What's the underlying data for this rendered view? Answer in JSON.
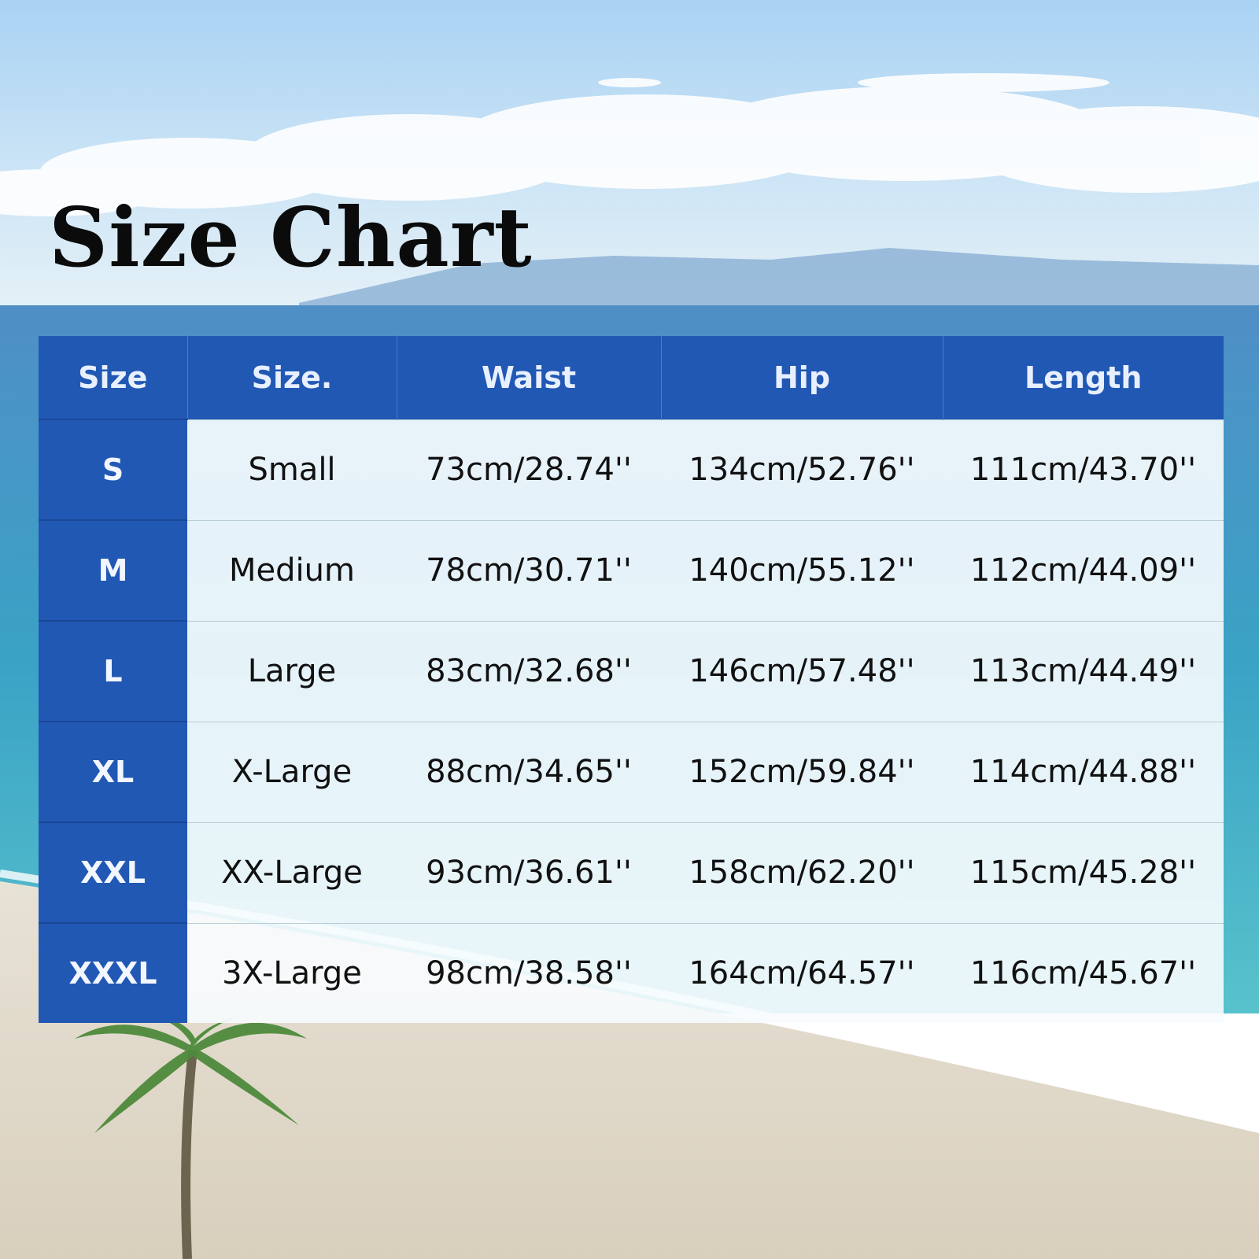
{
  "title": "Size Chart",
  "colors": {
    "header": "#2158b4",
    "cell_bg": "#f8fcfe",
    "text": "#111111"
  },
  "chart_data": {
    "type": "table",
    "title": "Size Chart",
    "columns": [
      "Size",
      "Size.",
      "Waist",
      "Hip",
      "Length"
    ],
    "rows": [
      [
        "S",
        "Small",
        "73cm/28.74''",
        "134cm/52.76''",
        "111cm/43.70''"
      ],
      [
        "M",
        "Medium",
        "78cm/30.71''",
        "140cm/55.12''",
        "112cm/44.09''"
      ],
      [
        "L",
        "Large",
        "83cm/32.68''",
        "146cm/57.48''",
        "113cm/44.49''"
      ],
      [
        "XL",
        "X-Large",
        "88cm/34.65''",
        "152cm/59.84''",
        "114cm/44.88''"
      ],
      [
        "XXL",
        "XX-Large",
        "93cm/36.61''",
        "158cm/62.20''",
        "115cm/45.28''"
      ],
      [
        "XXXL",
        "3X-Large",
        "98cm/38.58''",
        "164cm/64.57''",
        "116cm/45.67''"
      ]
    ]
  }
}
